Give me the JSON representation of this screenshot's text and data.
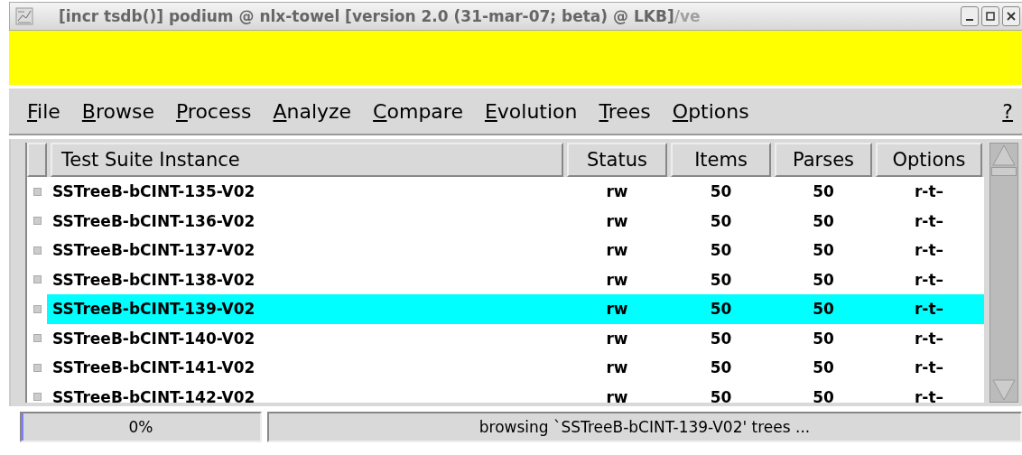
{
  "window": {
    "title": "[incr tsdb()] podium @ nlx-towel [version 2.0 (31-mar-07; beta) @ LKB]",
    "title_overflow": "/ve"
  },
  "menu": [
    "File",
    "Browse",
    "Process",
    "Analyze",
    "Compare",
    "Evolution",
    "Trees",
    "Options"
  ],
  "help": "?",
  "table": {
    "columns": [
      "Test Suite Instance",
      "Status",
      "Items",
      "Parses",
      "Options"
    ],
    "rows": [
      {
        "cells": [
          "SSTreeB-bCINT-135-V02",
          "rw",
          "50",
          "50",
          "r-t–"
        ],
        "selected": false
      },
      {
        "cells": [
          "SSTreeB-bCINT-136-V02",
          "rw",
          "50",
          "50",
          "r-t–"
        ],
        "selected": false
      },
      {
        "cells": [
          "SSTreeB-bCINT-137-V02",
          "rw",
          "50",
          "50",
          "r-t–"
        ],
        "selected": false
      },
      {
        "cells": [
          "SSTreeB-bCINT-138-V02",
          "rw",
          "50",
          "50",
          "r-t–"
        ],
        "selected": false
      },
      {
        "cells": [
          "SSTreeB-bCINT-139-V02",
          "rw",
          "50",
          "50",
          "r-t–"
        ],
        "selected": true
      },
      {
        "cells": [
          "SSTreeB-bCINT-140-V02",
          "rw",
          "50",
          "50",
          "r-t–"
        ],
        "selected": false
      },
      {
        "cells": [
          "SSTreeB-bCINT-141-V02",
          "rw",
          "50",
          "50",
          "r-t–"
        ],
        "selected": false
      },
      {
        "cells": [
          "SSTreeB-bCINT-142-V02",
          "rw",
          "50",
          "50",
          "r-t–"
        ],
        "selected": false
      }
    ]
  },
  "status_bar": {
    "progress": "0%",
    "level": 0,
    "message": "browsing `SSTreeB-bCINT-139-V02' trees ..."
  }
}
